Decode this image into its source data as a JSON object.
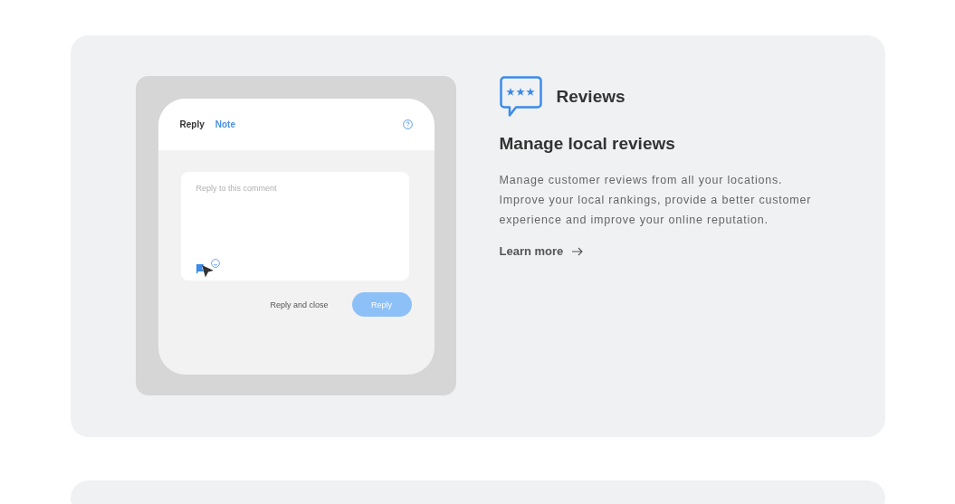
{
  "mockup": {
    "tabs": [
      {
        "label": "Reply",
        "selected": false
      },
      {
        "label": "Note",
        "selected": true
      }
    ],
    "reply_field": {
      "placeholder": "Reply to this comment"
    },
    "buttons": [
      {
        "label": "Reply and close",
        "kind": "text"
      },
      {
        "label": "Reply",
        "kind": "primary"
      }
    ]
  },
  "feature": {
    "name": "Reviews",
    "heading": "Manage local reviews",
    "description": "Manage customer reviews from all your locations. Improve your local rankings, provide a better customer experience and improve your online reputation.",
    "link": "Learn more"
  }
}
